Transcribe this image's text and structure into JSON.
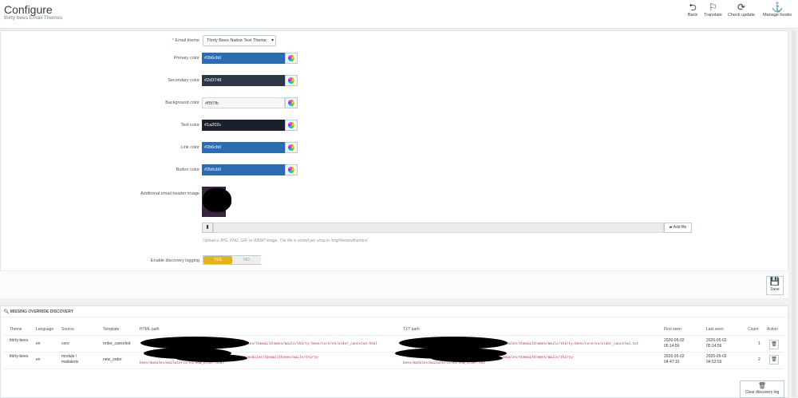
{
  "header": {
    "title": "Configure",
    "subtitle": "thirty bees Email Themes",
    "toolbar": [
      {
        "label": "Back",
        "icon": "back-icon"
      },
      {
        "label": "Translate",
        "icon": "flag-icon"
      },
      {
        "label": "Check update",
        "icon": "refresh-icon"
      },
      {
        "label": "Manage hooks",
        "icon": "anchor-icon"
      }
    ]
  },
  "form": {
    "email_theme_label": "Email theme",
    "email_theme_value": "Thirty Bees Native Text Theme",
    "colors": [
      {
        "label": "Primary color",
        "value": "#2b6cb0",
        "swatch": "#2b6cb0",
        "text": "#ffffff"
      },
      {
        "label": "Secondary color",
        "value": "#2d3748",
        "swatch": "#2d3748",
        "text": "#ffffff"
      },
      {
        "label": "Background color",
        "value": "#f5f7fb",
        "swatch": "#f5f7fb",
        "text": "#363a41"
      },
      {
        "label": "Text color",
        "value": "#1a202c",
        "swatch": "#1a202c",
        "text": "#ffffff"
      },
      {
        "label": "Link color",
        "value": "#2b6cb0",
        "swatch": "#2b6cb0",
        "text": "#ffffff"
      },
      {
        "label": "Button color",
        "value": "#2b6cb0",
        "swatch": "#2b6cb0",
        "text": "#ffffff"
      }
    ],
    "header_image_label": "Additional email header image",
    "add_file_label": "Add file",
    "help_text": "Upload a JPG, PNG, GIF, or WEBP image. The file is stored per shop in /img/themeslthemes/.",
    "discovery_label": "Enable discovery logging",
    "yes_label": "YES",
    "no_label": "NO",
    "save_label": "Save"
  },
  "discovery": {
    "title": "MISSING OVERRIDE DISCOVERY",
    "columns": [
      "Theme",
      "Language",
      "Source",
      "Template",
      "HTML path",
      "TXT path",
      "First seen",
      "Last seen",
      "Count",
      "Action"
    ],
    "rows": [
      {
        "theme": "thirty-bees",
        "language": "en",
        "source": "core",
        "template": "order_canceled",
        "html_path": "modules/tbemailthemes/mails/thirty-bees/core/en/order_canceled.html",
        "txt_path": "modules/tbemailthemes/mails/thirty-bees/core/en/order_canceled.txt",
        "first_seen": "2026-05-02 05:14:56",
        "last_seen": "2026-05-02 05:14:56",
        "count": "1"
      },
      {
        "theme": "thirty-bees",
        "language": "en",
        "source": "module / mailalerts",
        "template": "new_order",
        "html_path_a": "port.eu/modules/tbemailthemes/mails/thirty-",
        "html_path_b": "bees/modules/mailalerts/en/new_order.html",
        "txt_path_a": "modules/tbemailthemes/mails/thirty-",
        "txt_path_b": "bees/modules/mailalerts/en/new_order.txt",
        "first_seen": "2026-05-02 04:47:10",
        "last_seen": "2026-05-02 04:53:59",
        "count": "2"
      }
    ],
    "clear_label": "Clear discovery log"
  }
}
